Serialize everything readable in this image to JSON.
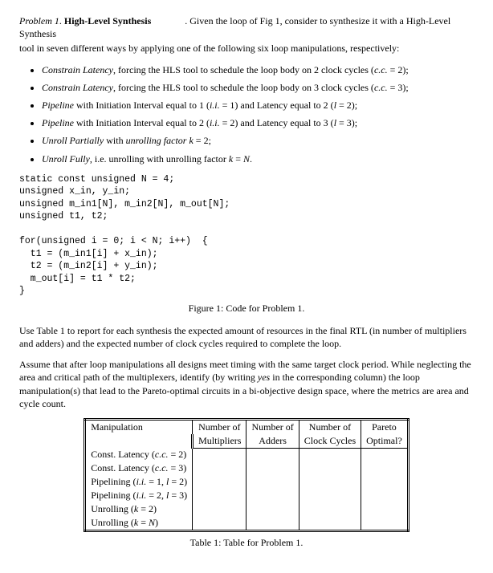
{
  "problem": {
    "label": "Problem",
    "number": "1",
    "title": "High-Level Synthesis",
    "intro_a": ". Given the loop of Fig 1, consider to synthesize it with a High-Level Synthesis",
    "intro_b": "tool in seven different ways by applying one of the following six loop manipulations, respectively:"
  },
  "bullets": [
    {
      "lead_i": "Constrain Latency",
      "rest": ", forcing the HLS tool to schedule the loop body on 2 clock cycles (",
      "tail_i": "c.c.",
      "tail": " = 2);"
    },
    {
      "lead_i": "Constrain Latency",
      "rest": ", forcing the HLS tool to schedule the loop body on 3 clock cycles (",
      "tail_i": "c.c.",
      "tail": " = 3);"
    },
    {
      "lead_i": "Pipeline",
      "rest": " with Initiation Interval equal to 1 (",
      "tail_i": "i.i.",
      "tail": " = 1) and Latency equal to 2 (",
      "tail2_i": "l",
      "tail2": " = 2);"
    },
    {
      "lead_i": "Pipeline",
      "rest": " with Initiation Interval equal to 2 (",
      "tail_i": "i.i.",
      "tail": " = 2) and Latency equal to 3 (",
      "tail2_i": "l",
      "tail2": " = 3);"
    },
    {
      "lead_i": "Unroll Partially",
      "rest": " with ",
      "mid_i": "unrolling factor",
      "mid": " ",
      "tail_i": "k",
      "tail": " = 2;"
    },
    {
      "lead_i": "Unroll Fully",
      "rest": ", i.e. unrolling with unrolling factor ",
      "tail_i": "k",
      "tail": " = ",
      "tail2_i": "N",
      "tail2": "."
    }
  ],
  "code": "static const unsigned N = 4;\nunsigned x_in, y_in;\nunsigned m_in1[N], m_in2[N], m_out[N];\nunsigned t1, t2;\n\nfor(unsigned i = 0; i < N; i++)  {\n  t1 = (m_in1[i] + x_in);\n  t2 = (m_in2[i] + y_in);\n  m_out[i] = t1 * t2;\n}",
  "figure_caption": "Figure 1: Code for Problem 1.",
  "para1": "Use Table 1 to report for each synthesis the expected amount of resources in the final RTL (in number of multipliers and adders) and the expected number of clock cycles required to complete the loop.",
  "para2_a": "Assume that after loop manipulations all designs meet timing with the same target clock period. While neglecting the area and critical path of the multiplexers, identify (by writing ",
  "para2_i": "yes",
  "para2_b": " in the corresponding column) the loop manipulation(s) that lead to the Pareto-optimal circuits in a bi-objective design space, where the metrics are area and cycle count.",
  "table": {
    "headers": {
      "c1": "Manipulation",
      "c2a": "Number of",
      "c2b": "Multipliers",
      "c3a": "Number of",
      "c3b": "Adders",
      "c4a": "Number of",
      "c4b": "Clock Cycles",
      "c5a": "Pareto",
      "c5b": "Optimal?"
    },
    "rows": [
      {
        "label": "Const. Latency (c.c. = 2)"
      },
      {
        "label": "Const. Latency (c.c. = 3)"
      },
      {
        "label": "Pipelining (i.i. = 1, l = 2)"
      },
      {
        "label": "Pipelining (i.i. = 2, l = 3)"
      },
      {
        "label": "Unrolling (k = 2)"
      },
      {
        "label": "Unrolling (k = N)"
      }
    ]
  },
  "table_caption": "Table 1: Table for Problem 1."
}
